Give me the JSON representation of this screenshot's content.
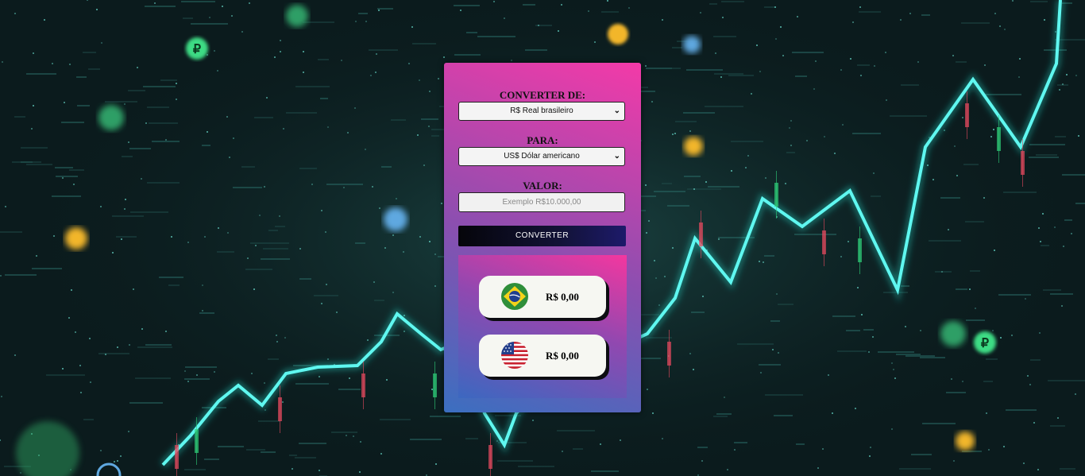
{
  "form": {
    "from_label": "CONVERTER DE:",
    "from_value": "R$ Real brasileiro",
    "to_label": "PARA:",
    "to_value": "US$ Dólar americano",
    "value_label": "VALOR:",
    "value_placeholder": "Exemplo R$10.000,00",
    "button_label": "CONVERTER"
  },
  "results": [
    {
      "flag": "brazil-flag-icon",
      "amount": "R$ 0,00"
    },
    {
      "flag": "usa-flag-icon",
      "amount": "R$ 0,00"
    }
  ],
  "colors": {
    "card_top": "#f33aa8",
    "card_bottom": "#3b6fc0",
    "button": "#121236",
    "chart_line": "#2ff0e0"
  }
}
